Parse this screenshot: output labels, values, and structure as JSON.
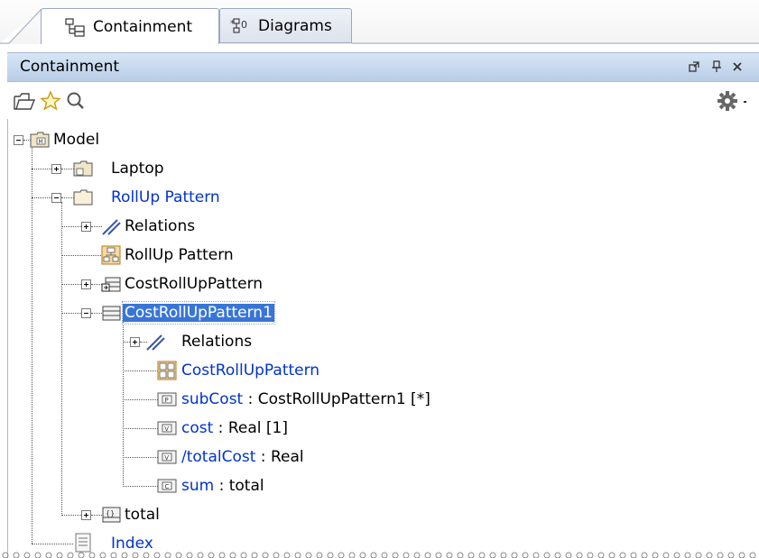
{
  "tabs": [
    {
      "label": "Containment",
      "icon": "containment-icon",
      "active": true
    },
    {
      "label": "Diagrams",
      "icon": "diagrams-icon",
      "active": false
    }
  ],
  "panel": {
    "title": "Containment",
    "buttons": [
      "restore-icon",
      "pin-icon",
      "close-icon"
    ]
  },
  "toolbar": {
    "left_tools": [
      "open-folder-icon",
      "favorite-star-icon",
      "search-icon"
    ],
    "right_tools": [
      "gear-icon"
    ]
  },
  "tree": {
    "model": {
      "label": "Model"
    },
    "laptop": {
      "label": "Laptop"
    },
    "rollup_pkg": {
      "label": "RollUp Pattern"
    },
    "relations1": {
      "label": "Relations"
    },
    "rollup_diagram": {
      "label": "RollUp Pattern"
    },
    "costrollup": {
      "label": "CostRollUpPattern"
    },
    "costrollup1": {
      "label": "CostRollUpPattern1"
    },
    "relations2": {
      "label": "Relations"
    },
    "costrollup_diagram": {
      "label": "CostRollUpPattern"
    },
    "subcost": {
      "name": "subCost",
      "type": " : CostRollUpPattern1 [*]"
    },
    "cost": {
      "name": "cost",
      "type": " : Real [1]"
    },
    "totalcost": {
      "name": "/totalCost",
      "type": " : Real"
    },
    "sum": {
      "name": "sum",
      "type": " : total"
    },
    "total": {
      "label": "total"
    },
    "index": {
      "label": "Index"
    }
  },
  "colors": {
    "link_blue": "#0033cc",
    "selection": "#3875d7",
    "titlebar": "#c8daf0"
  }
}
